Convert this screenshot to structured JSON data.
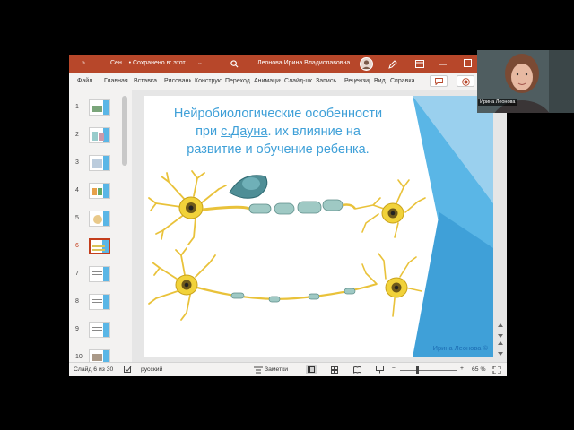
{
  "titlebar": {
    "overflow_label": "»",
    "doc_name": "Сен... • Сохранено в: этот...",
    "user_name": "Леонова Ирина Владиславовна"
  },
  "ribbon": {
    "tabs": [
      "Файл",
      "Главная",
      "Вставка",
      "Рисование",
      "Конструктор",
      "Переходы",
      "Анимация",
      "Слайд-шоу",
      "Запись",
      "Рецензирование",
      "Вид",
      "Справка"
    ]
  },
  "thumbnails": {
    "items": [
      {
        "num": "1"
      },
      {
        "num": "2"
      },
      {
        "num": "3"
      },
      {
        "num": "4"
      },
      {
        "num": "5"
      },
      {
        "num": "6",
        "active": true
      },
      {
        "num": "7"
      },
      {
        "num": "8"
      },
      {
        "num": "9"
      },
      {
        "num": "10"
      }
    ]
  },
  "slide": {
    "title_line1": "Нейробиологические особенности",
    "title_pre": "при ",
    "title_link": "с.Дауна",
    "title_post": ". их влияние на",
    "title_line3": "развитие и обучение ребенка.",
    "author": "Ирина Леонова ©"
  },
  "statusbar": {
    "slide_counter": "Слайд 6 из 30",
    "language": "русский",
    "notes_label": "Заметки",
    "zoom": "65 %"
  },
  "webcam": {
    "participant": "Ирина Леонова"
  },
  "colors": {
    "accent": "#b7472a",
    "title_blue": "#3fa0d8",
    "slide_triangle": "#5ab6e6"
  }
}
